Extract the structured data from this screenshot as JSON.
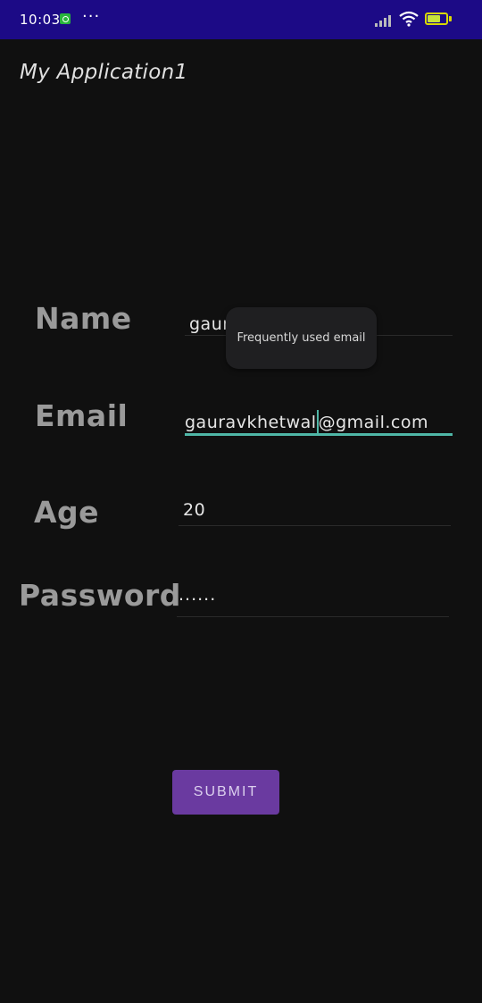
{
  "status_bar": {
    "time": "10:03",
    "more": "···"
  },
  "app": {
    "title": "My Application1"
  },
  "form": {
    "name": {
      "label": "Name",
      "value": "gaur"
    },
    "email": {
      "label": "Email",
      "value_before_cursor": "gauravkhetwal",
      "value_after_cursor": "@gmail.com"
    },
    "age": {
      "label": "Age",
      "value": "20"
    },
    "password": {
      "label": "Password",
      "value": "......"
    }
  },
  "autofill_tooltip": {
    "text": "Frequently used email"
  },
  "submit_button": {
    "label": "SUBMIT"
  },
  "colors": {
    "status_bar": "#1c0a86",
    "background": "#101010",
    "accent": "#4fb7a7",
    "button": "#6a3aa0"
  }
}
